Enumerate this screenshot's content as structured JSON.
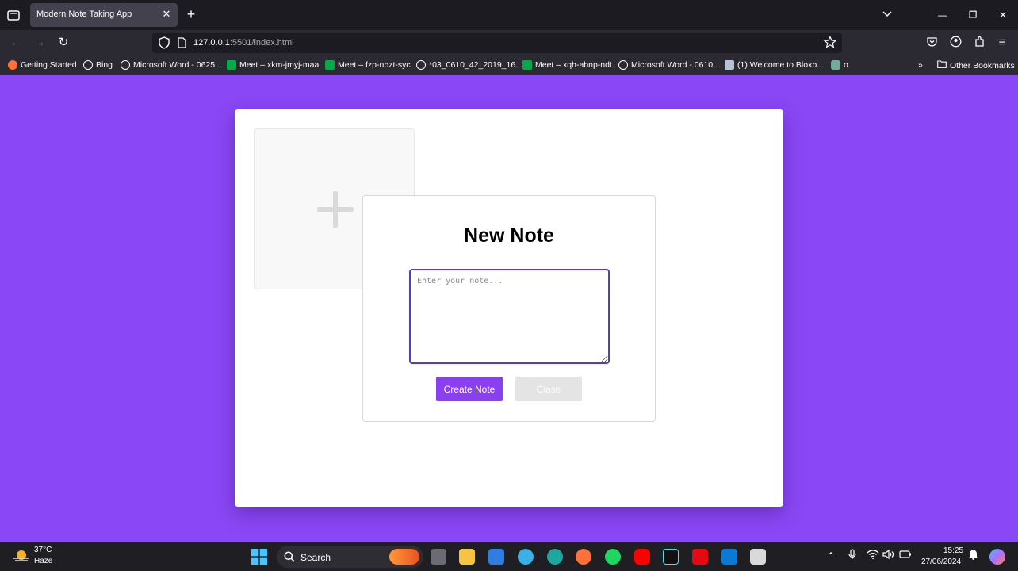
{
  "browser": {
    "tab_title": "Modern Note Taking App",
    "url_host": "127.0.0.1",
    "url_path": ":5501/index.html",
    "bookmarks": [
      {
        "label": "Getting Started",
        "icon": "firefox-icon"
      },
      {
        "label": "Bing",
        "icon": "globe-icon"
      },
      {
        "label": "Microsoft Word - 0625...",
        "icon": "globe-icon"
      },
      {
        "label": "Meet – xkm-jmyj-maa",
        "icon": "meet-icon"
      },
      {
        "label": "Meet – fzp-nbzt-syc",
        "icon": "meet-icon"
      },
      {
        "label": "*03_0610_42_2019_16...",
        "icon": "globe-icon"
      },
      {
        "label": "Meet – xqh-abnp-ndt",
        "icon": "meet-icon"
      },
      {
        "label": "Microsoft Word - 0610...",
        "icon": "globe-icon"
      },
      {
        "label": "(1) Welcome to Bloxb...",
        "icon": "roblox-icon"
      },
      {
        "label": "o",
        "icon": "chatgpt-icon"
      }
    ],
    "other_bookmarks": "Other Bookmarks"
  },
  "app": {
    "modal_title": "New Note",
    "note_placeholder": "Enter your note...",
    "create_label": "Create Note",
    "close_label": "Close"
  },
  "taskbar": {
    "temperature": "37°C",
    "condition": "Haze",
    "search_label": "Search",
    "time": "15:25",
    "date": "27/06/2024"
  },
  "colors": {
    "page_background": "#8a47f5",
    "accent_button": "#8a3ff0",
    "textarea_border": "#4f3cd0"
  }
}
